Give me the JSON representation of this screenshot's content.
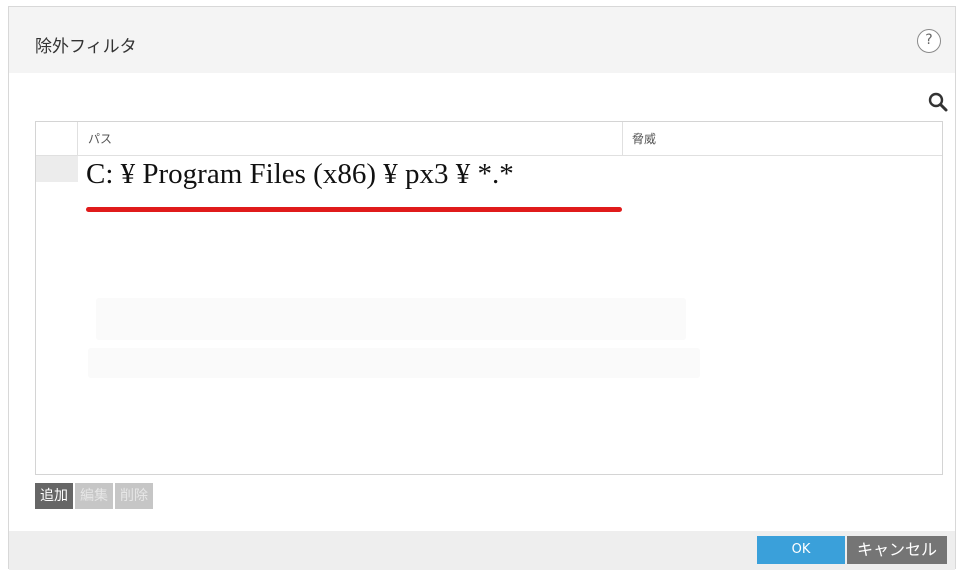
{
  "dialog": {
    "title": "除外フィルタ",
    "help_label": "?"
  },
  "table": {
    "columns": {
      "path": "パス",
      "threat": "脅威"
    },
    "rows": [
      {
        "path": "C: ¥ Program Files (x86) ¥ px3 ¥ *.*",
        "threat": ""
      }
    ]
  },
  "actions": {
    "add": "追加",
    "edit": "編集",
    "delete": "削除"
  },
  "footer": {
    "ok": "OK",
    "cancel": "キャンセル"
  },
  "colors": {
    "ok_button": "#3aa0da",
    "cancel_button": "#757575",
    "add_button": "#666666",
    "disabled_button": "#c6c6c6",
    "highlight_underline": "#e01b1b"
  },
  "icons": {
    "help": "help-icon",
    "search": "search-icon"
  }
}
